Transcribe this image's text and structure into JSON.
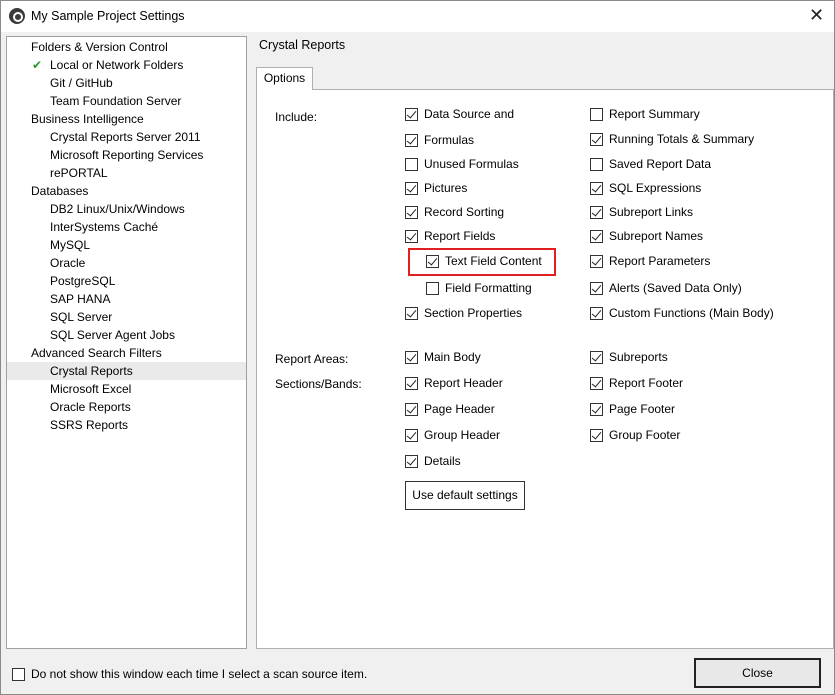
{
  "window": {
    "title": "My Sample Project Settings",
    "close_glyph": "✕"
  },
  "tree": {
    "items": [
      {
        "label": "Folders & Version Control",
        "level": 0
      },
      {
        "label": "Local or Network Folders",
        "level": 1,
        "checked": true
      },
      {
        "label": "Git / GitHub",
        "level": 1
      },
      {
        "label": "Team Foundation Server",
        "level": 1
      },
      {
        "label": "Business Intelligence",
        "level": 0
      },
      {
        "label": "Crystal Reports Server 2011",
        "level": 1
      },
      {
        "label": "Microsoft Reporting Services",
        "level": 1
      },
      {
        "label": "rePORTAL",
        "level": 1
      },
      {
        "label": "Databases",
        "level": 0
      },
      {
        "label": "DB2 Linux/Unix/Windows",
        "level": 1
      },
      {
        "label": "InterSystems Caché",
        "level": 1
      },
      {
        "label": "MySQL",
        "level": 1
      },
      {
        "label": "Oracle",
        "level": 1
      },
      {
        "label": "PostgreSQL",
        "level": 1
      },
      {
        "label": "SAP HANA",
        "level": 1
      },
      {
        "label": "SQL Server",
        "level": 1
      },
      {
        "label": "SQL Server Agent Jobs",
        "level": 1
      },
      {
        "label": "Advanced Search Filters",
        "level": 0
      },
      {
        "label": "Crystal Reports",
        "level": 1,
        "selected": true
      },
      {
        "label": "Microsoft Excel",
        "level": 1
      },
      {
        "label": "Oracle Reports",
        "level": 1
      },
      {
        "label": "SSRS Reports",
        "level": 1
      }
    ]
  },
  "panel": {
    "header": "Crystal Reports",
    "tab": "Options",
    "labels": {
      "include": "Include:",
      "report_areas": "Report Areas:",
      "sections_bands": "Sections/Bands:"
    },
    "include_left": [
      {
        "label": "Data Source and",
        "checked": true
      },
      {
        "label": "Formulas",
        "checked": true
      },
      {
        "label": "Unused Formulas",
        "checked": false
      },
      {
        "label": "Pictures",
        "checked": true
      },
      {
        "label": "Record Sorting",
        "checked": true
      },
      {
        "label": "Report Fields",
        "checked": true
      },
      {
        "label": "Text Field Content",
        "checked": true,
        "indent": true
      },
      {
        "label": "Field Formatting",
        "checked": false,
        "indent": true
      },
      {
        "label": "Section Properties",
        "checked": true
      }
    ],
    "include_right": [
      {
        "label": "Report Summary",
        "checked": false
      },
      {
        "label": "Running Totals & Summary",
        "checked": true
      },
      {
        "label": "Saved Report Data",
        "checked": false
      },
      {
        "label": "SQL Expressions",
        "checked": true
      },
      {
        "label": "Subreport Links",
        "checked": true
      },
      {
        "label": "Subreport Names",
        "checked": true
      },
      {
        "label": "Report Parameters",
        "checked": true
      },
      {
        "label": "Alerts (Saved Data Only)",
        "checked": true
      },
      {
        "label": "Custom Functions (Main Body)",
        "checked": true
      }
    ],
    "areas_left": [
      {
        "label": "Main Body",
        "checked": true
      },
      {
        "label": "Report Header",
        "checked": true
      },
      {
        "label": "Page Header",
        "checked": true
      },
      {
        "label": "Group Header",
        "checked": true
      },
      {
        "label": "Details",
        "checked": true
      }
    ],
    "areas_right": [
      {
        "label": "Subreports",
        "checked": true
      },
      {
        "label": "Report Footer",
        "checked": true
      },
      {
        "label": "Page Footer",
        "checked": true
      },
      {
        "label": "Group Footer",
        "checked": true
      }
    ],
    "default_button": "Use default settings",
    "highlight_color": "#e02020"
  },
  "footer": {
    "dont_show_label": "Do not show this window each time I select a scan source item.",
    "dont_show_checked": false,
    "close_label": "Close"
  }
}
